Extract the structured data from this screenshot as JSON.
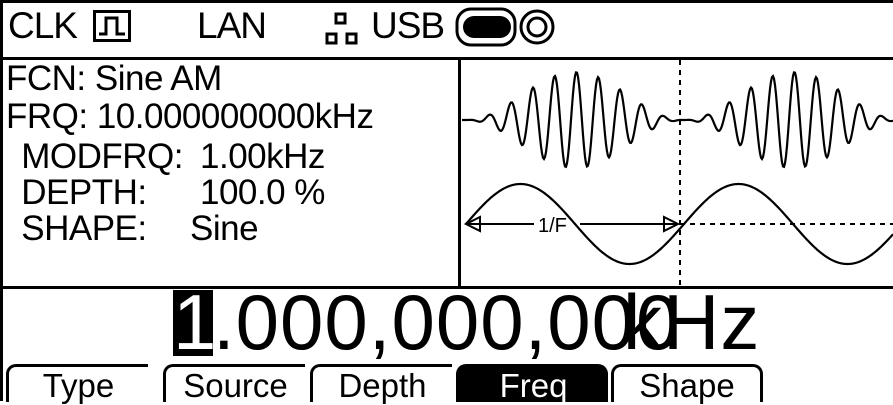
{
  "status_bar": {
    "clk_label": "CLK",
    "lan_label": "LAN",
    "usb_label": "USB",
    "clk_icon": "square-wave-icon",
    "lan_icon": "network-icon",
    "usb_icon": "usb-stick-icon"
  },
  "info": {
    "function": "FCN: Sine AM",
    "frequency": "FRQ: 10.000000000kHz",
    "modfrq_label": " MODFRQ:",
    "modfrq_value": "1.00kHz",
    "depth_label": " DEPTH:",
    "depth_value": "100.0 %",
    "shape_label": " SHAPE:",
    "shape_value": "Sine"
  },
  "waveform": {
    "marker_label": "1/F"
  },
  "value": {
    "cursor_digit": "1",
    "rest": ".000,000,000",
    "unit": "kHz"
  },
  "softkeys": [
    {
      "label": "Type",
      "active": false
    },
    {
      "label": "Source",
      "active": false
    },
    {
      "label": "Depth",
      "active": false
    },
    {
      "label": "Freq",
      "active": true
    },
    {
      "label": "Shape",
      "active": false
    }
  ]
}
